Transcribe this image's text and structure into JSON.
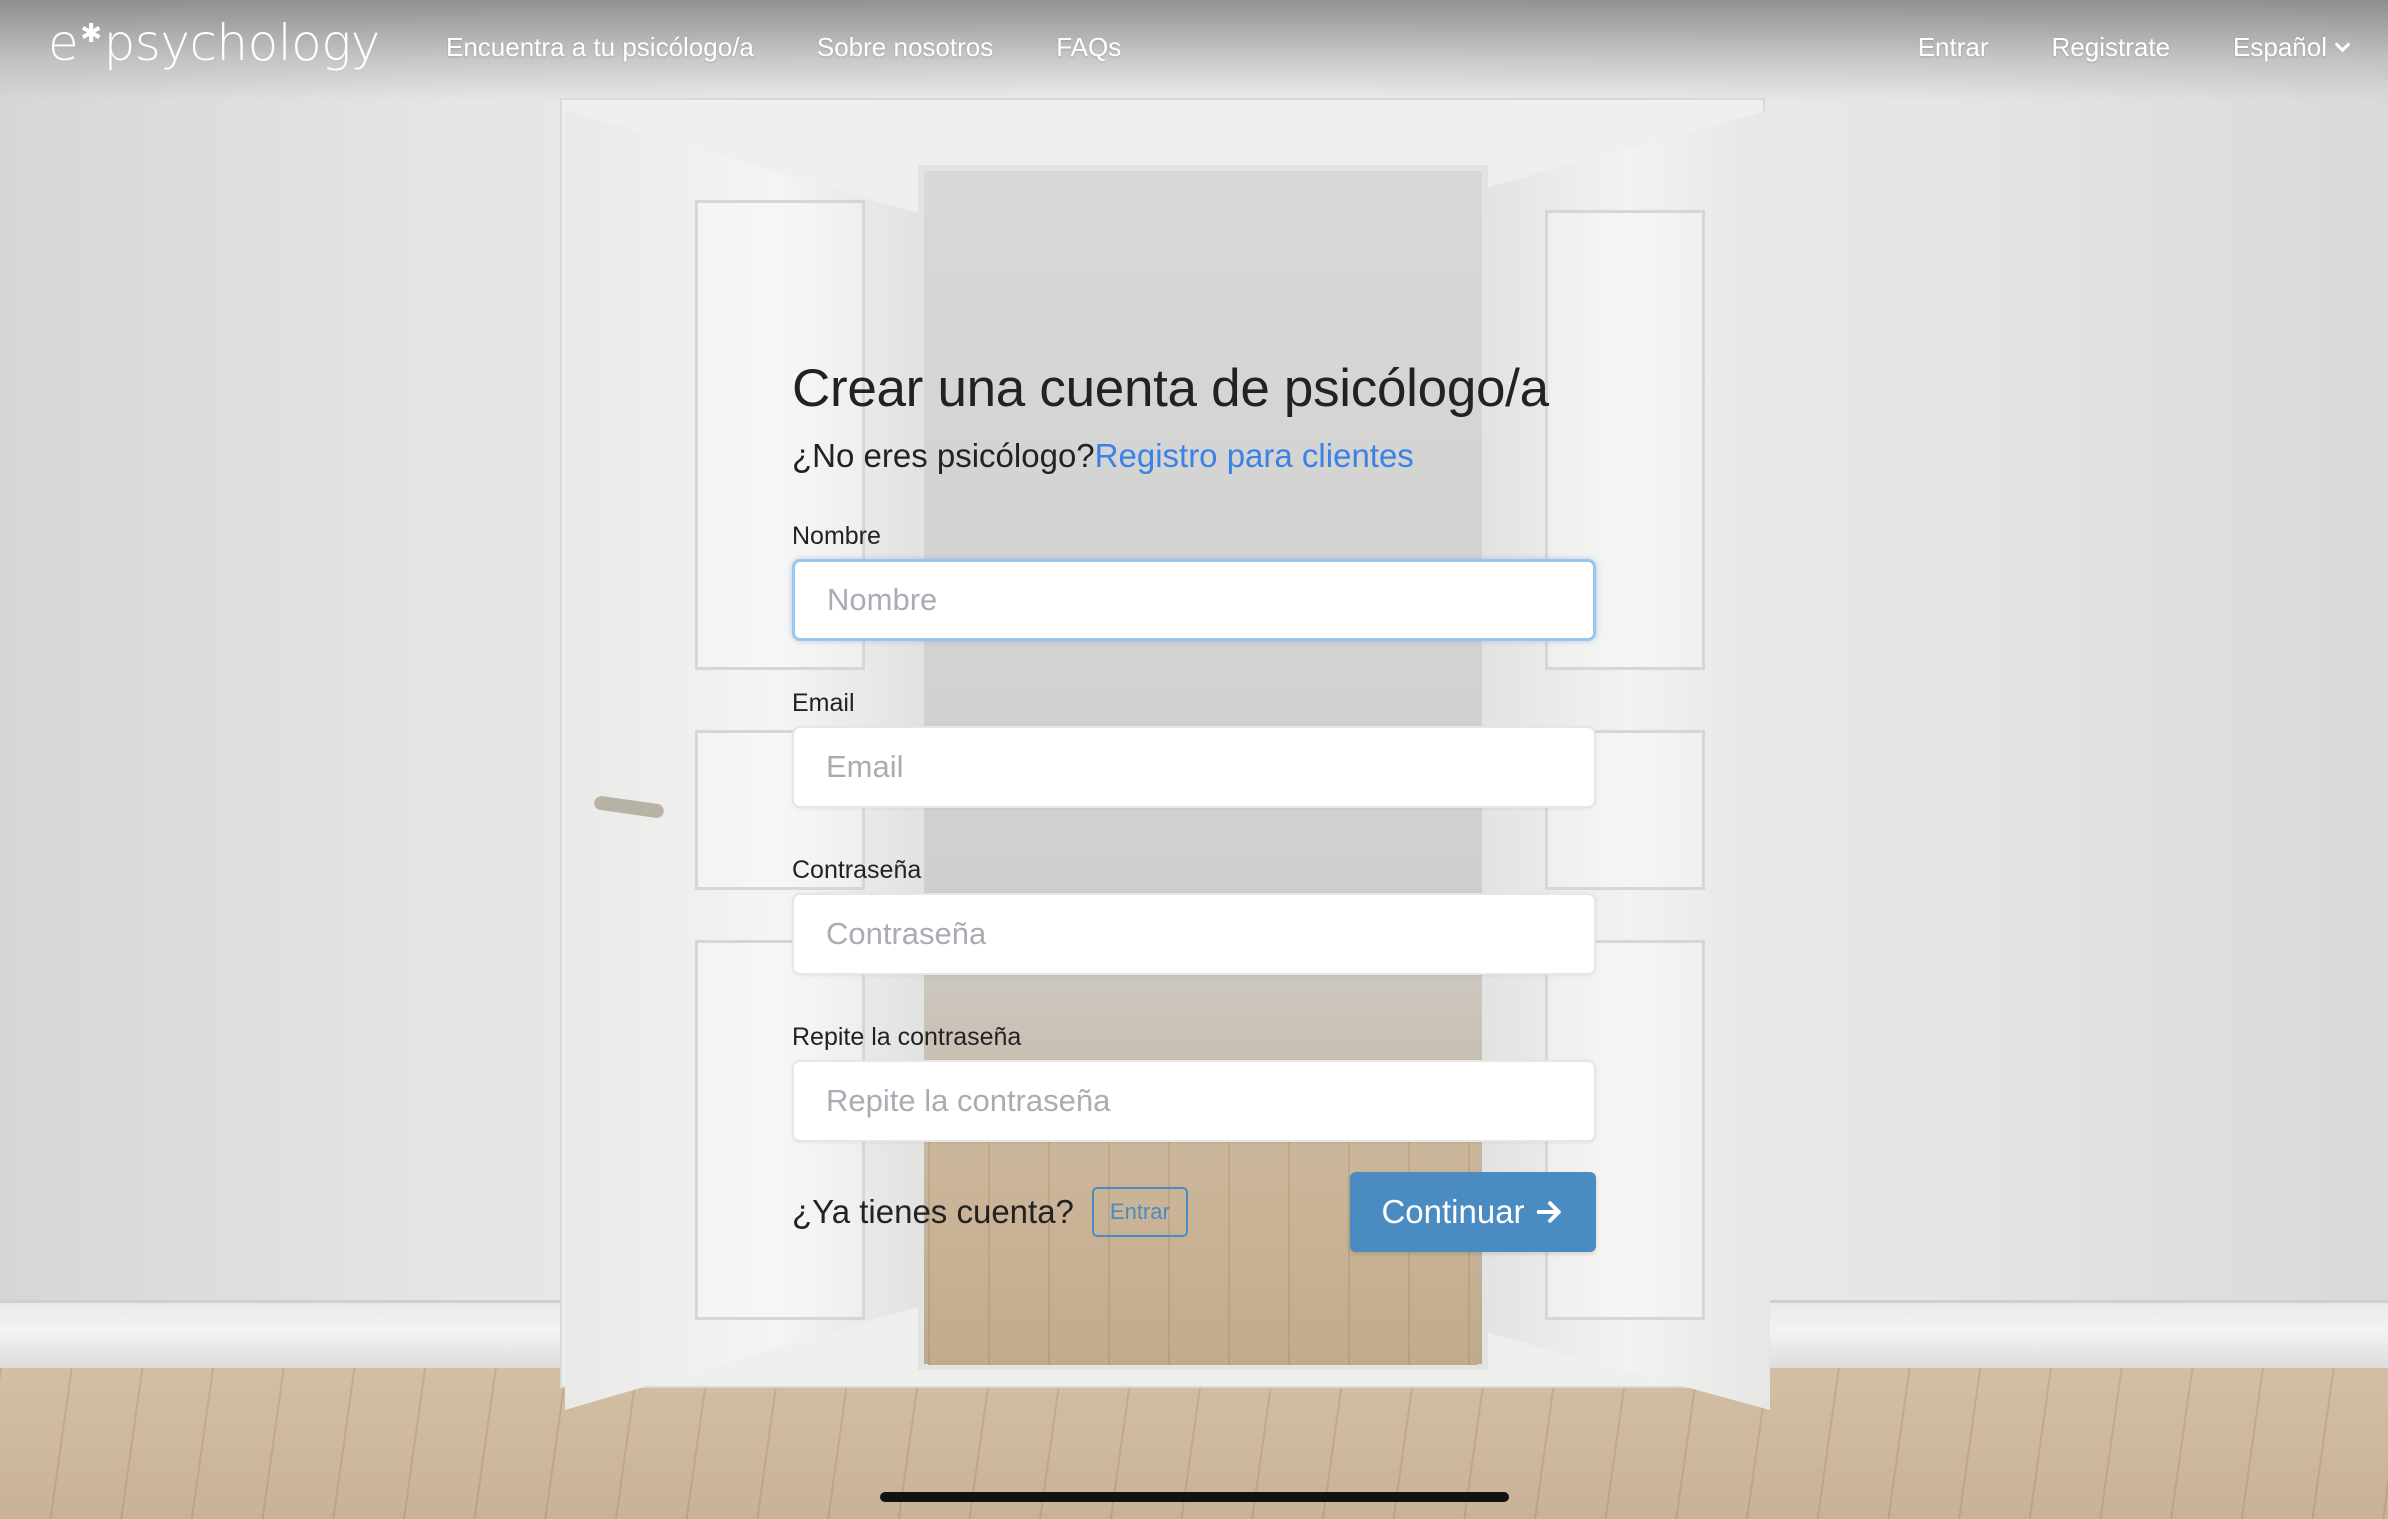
{
  "logo": {
    "prefix": "e",
    "star": "✱",
    "suffix": "psychology"
  },
  "nav": {
    "left": [
      {
        "label": "Encuentra a tu psicólogo/a"
      },
      {
        "label": "Sobre nosotros"
      },
      {
        "label": "FAQs"
      }
    ],
    "right": {
      "login": "Entrar",
      "register": "Registrate",
      "language": "Español"
    }
  },
  "form": {
    "title": "Crear una cuenta de psicólogo/a",
    "subtitle_prefix": "¿No eres psicólogo?",
    "subtitle_link": "Registro para clientes",
    "fields": [
      {
        "label": "Nombre",
        "placeholder": "Nombre",
        "value": ""
      },
      {
        "label": "Email",
        "placeholder": "Email",
        "value": ""
      },
      {
        "label": "Contraseña",
        "placeholder": "Contraseña",
        "value": ""
      },
      {
        "label": "Repite la contraseña",
        "placeholder": "Repite la contraseña",
        "value": ""
      }
    ],
    "have_account": "¿Ya tienes cuenta?",
    "login_button": "Entrar",
    "continue_button": "Continuar"
  },
  "colors": {
    "accent": "#4a8bc2",
    "link": "#3b82e6",
    "focus_border": "#9cc7ec"
  }
}
